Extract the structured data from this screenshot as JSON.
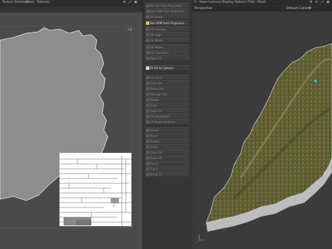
{
  "uv_editor": {
    "menu": [
      "Texture Selection",
      "Paint",
      "Textures"
    ],
    "label_top_right": "1.0",
    "label_bottom_right": "1.0"
  },
  "tools": {
    "items_top": [
      "Set UV From Projection",
      "Set UVW From Projection",
      "UV Relax",
      "UV Unwrap",
      "UV Align",
      "UV Mirror"
    ],
    "highlight_1": "Set UVW from Projection...",
    "items_mid": [
      "UV Peeler",
      "UV Transform",
      "Pack UV",
      "UV Shell",
      "Grid UVs",
      "Relax UVs",
      "Unwrap UVs"
    ],
    "highlight_2": "Fit UV to Camera",
    "items_lower": [
      "Rotate",
      "Scale",
      "Align UV",
      "UV Straighten",
      "UV Rectangularize",
      "Align to Vertical",
      "Distribute UVs",
      "Equalize UVs",
      "Normalize UVs",
      "Cut UVs"
    ],
    "items_bottom": [
      "Select",
      "Move",
      "Rotate",
      "Scale",
      "Copy UV",
      "Paste UV",
      "Flip U",
      "Flip V",
      "Mirror U",
      "Mirror V",
      "Snap UV",
      "Selection"
    ]
  },
  "viewport": {
    "menu": [
      "View",
      "Cameras",
      "Display",
      "Options",
      "Filter",
      "Panel"
    ],
    "name": "Perspective",
    "camera": "Default Camera"
  }
}
